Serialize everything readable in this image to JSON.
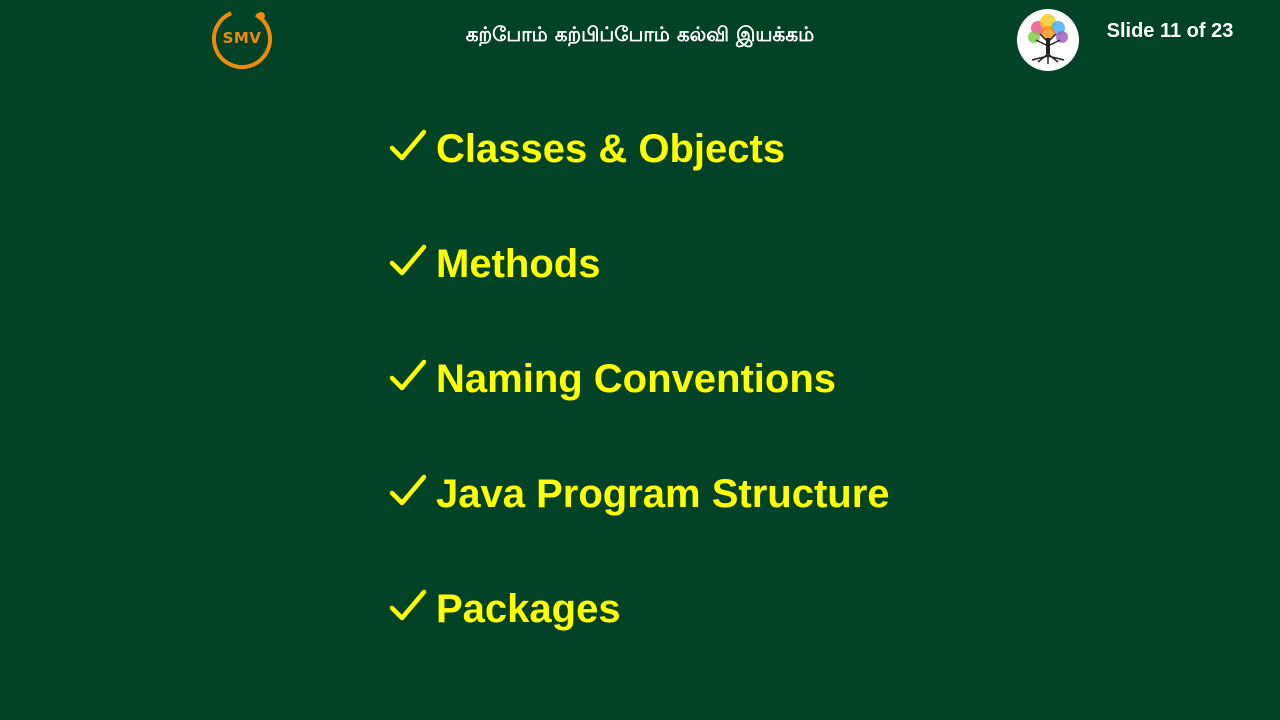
{
  "header": {
    "logo_text": "SMV",
    "tagline": "கற்போம் கற்பிப்போம் கல்வி இயக்கம்",
    "slide_counter": "Slide 11 of 23"
  },
  "bullets": [
    {
      "label": "Classes & Objects",
      "icon": "check-icon"
    },
    {
      "label": "Methods",
      "icon": "check-icon"
    },
    {
      "label": "Naming Conventions",
      "icon": "check-icon"
    },
    {
      "label": "Java Program Structure",
      "icon": "check-icon"
    },
    {
      "label": "Packages",
      "icon": "check-icon"
    }
  ],
  "colors": {
    "background": "#024226",
    "bullet_text": "#ffff00",
    "header_text": "#ffffff",
    "logo_accent": "#f08a0c"
  }
}
